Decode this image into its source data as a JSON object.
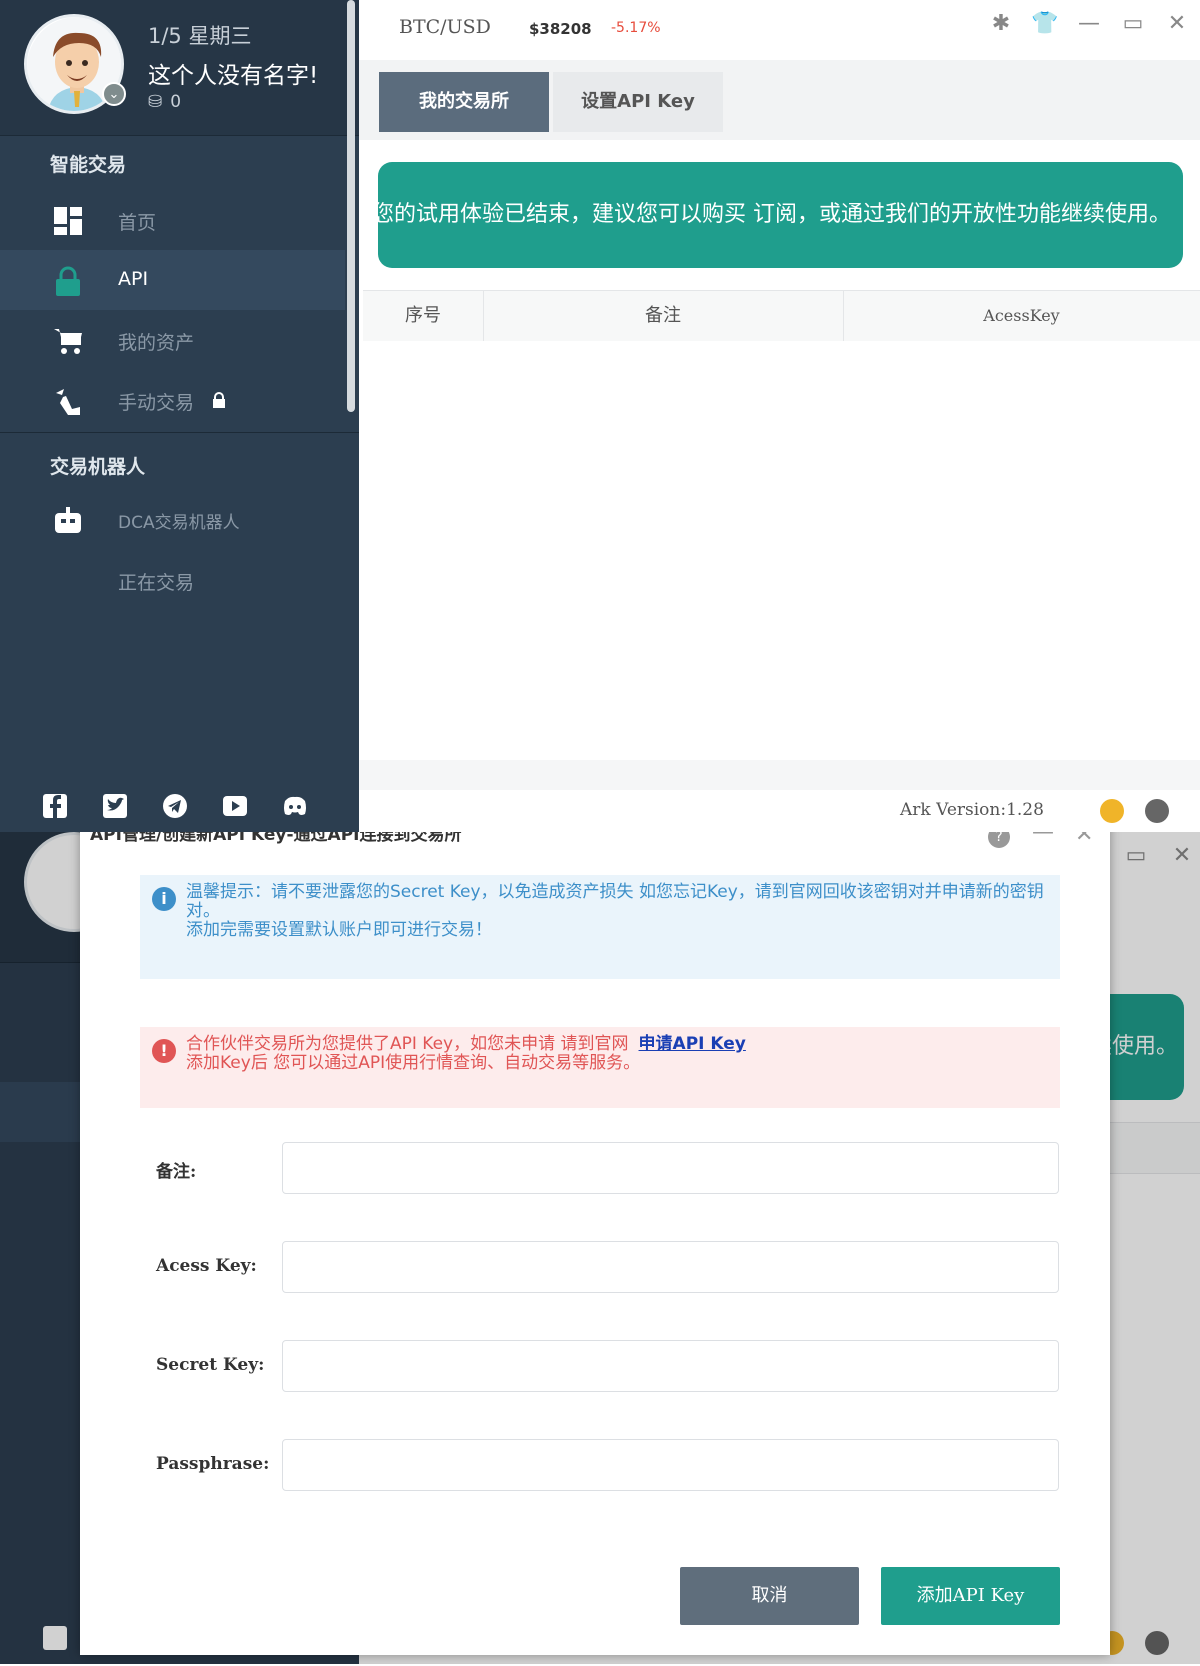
{
  "sidebar": {
    "date": "1/5 星期三",
    "username": "这个人没有名字!",
    "coins": "0",
    "section_smart": "智能交易",
    "section_robot": "交易机器人",
    "items": [
      {
        "label": "首页"
      },
      {
        "label": "API"
      },
      {
        "label": "我的资产"
      },
      {
        "label": "手动交易"
      },
      {
        "label": "DCA交易机器人"
      },
      {
        "label": "正在交易"
      }
    ]
  },
  "topbar": {
    "pair": "BTC/USD",
    "price": "$38208",
    "change": "-5.17%"
  },
  "tabs": [
    {
      "label": "我的交易所"
    },
    {
      "label": "设置API Key"
    }
  ],
  "banner": "您的试用体验已结束，建议您可以购买 订阅，或通过我们的开放性功能继续使用。",
  "banner_partial": "续使用。",
  "table": {
    "columns": [
      "序号",
      "备注",
      "AcessKey"
    ]
  },
  "footer": {
    "version": "Ark  Version:1.28"
  },
  "dialog": {
    "title": "API管理/创建新API Key-通过API连接到交易所",
    "info_line1": "温馨提示：请不要泄露您的Secret Key，以免造成资产损失 如您忘记Key，请到官网回收该密钥对并申请新的密钥对。",
    "info_line2": "添加完需要设置默认账户即可进行交易！",
    "warn_line1": "合作伙伴交易所为您提供了API Key，如您未申请 请到官网",
    "warn_link": "申请API Key",
    "warn_line2": "添加Key后 您可以通过API使用行情查询、自动交易等服务。",
    "fields": [
      {
        "label": "备注:",
        "value": ""
      },
      {
        "label": "Acess Key:",
        "value": ""
      },
      {
        "label": "Secret Key:",
        "value": ""
      },
      {
        "label": "Passphrase:",
        "value": ""
      }
    ],
    "cancel_label": "取消",
    "add_label": "添加API Key"
  },
  "colors": {
    "sidebar_bg": "#2c3e50",
    "accent_teal": "#1f9e8d",
    "change_red": "#e74c3c",
    "status_yellow": "#f0b429",
    "status_gray": "#666666"
  }
}
